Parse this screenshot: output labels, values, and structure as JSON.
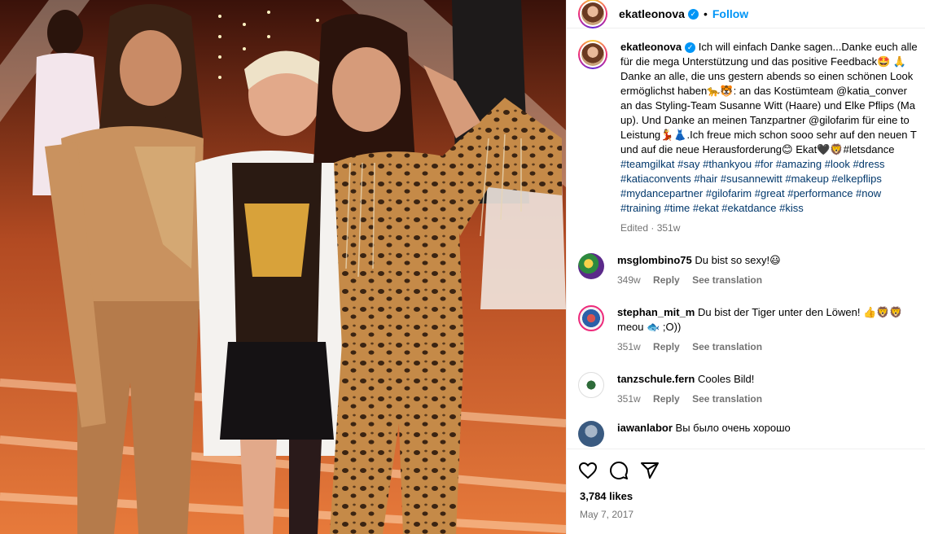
{
  "post": {
    "username": "ekatleonova",
    "follow_label": "Follow",
    "dot": "•",
    "caption_lines": [
      "Ich will einfach Danke sagen...Danke euch alle",
      "für die mega Unterstützung und das positive Feedback🤩 🙏",
      "Danke an alle, die uns gestern abends so einen schönen Look",
      "ermöglichst haben🐆🐯: an das Kostümteam @katia_conver",
      "an das Styling-Team Susanne Witt (Haare) und Elke Pflips (Ma",
      "up). Und Danke an meinen Tanzpartner @gilofarim für eine to",
      "Leistung💃👗.Ich freue mich schon sooo sehr auf den neuen T",
      "und auf die neue Herausforderung😊 Ekat🖤🦁#letsdance",
      "#teamgilkat #say #thankyou #for #amazing #look #dress",
      "#katiaconvents #hair #susannewitt #makeup #elkepflips",
      "#mydancepartner #gilofarim #great #performance #now",
      "#training #time #ekat #ekatdance #kiss"
    ],
    "caption_meta": "Edited · 351w",
    "likes": "3,784 likes",
    "date": "May 7, 2017"
  },
  "comments": [
    {
      "username": "msglombino75",
      "text": "Du bist so sexy!😃",
      "age": "349w",
      "reply_label": "Reply",
      "translate_label": "See translation"
    },
    {
      "username": "stephan_mit_m",
      "text": "Du bist der Tiger unter den Löwen! 👍🦁🦁",
      "text2": "meou 🐟 ;O))",
      "age": "351w",
      "reply_label": "Reply",
      "translate_label": "See translation"
    },
    {
      "username": "tanzschule.fern",
      "text": "Cooles Bild!",
      "age": "351w",
      "reply_label": "Reply",
      "translate_label": "See translation"
    },
    {
      "username": "iawanlabor",
      "text": "Вы было очень хорошо"
    }
  ],
  "icons": {
    "like": "heart-icon",
    "comment": "comment-icon",
    "share": "share-icon",
    "verified": "verified-badge-icon"
  },
  "colors": {
    "accent": "#0095f6",
    "link": "#00376b",
    "muted": "#737373",
    "photo_bg": "#9a3b1c"
  }
}
